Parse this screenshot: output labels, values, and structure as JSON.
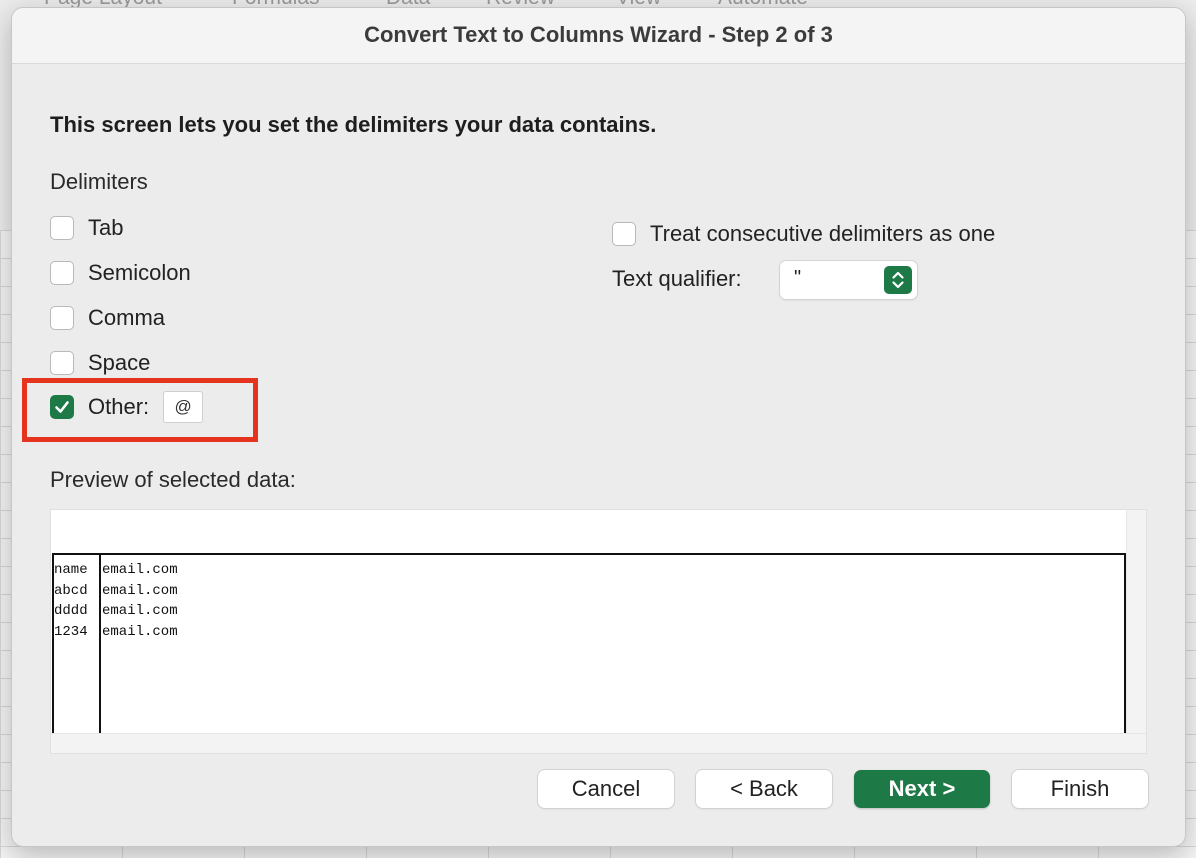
{
  "background": {
    "ribbon_tabs": [
      "Page Layout",
      "Formulas",
      "Data",
      "Review",
      "View",
      "Automate"
    ]
  },
  "dialog": {
    "title": "Convert Text to Columns Wizard - Step 2 of 3",
    "intro": "This screen lets you set the delimiters your data contains.",
    "delimiters_label": "Delimiters",
    "delimiters": [
      {
        "label": "Tab",
        "checked": false
      },
      {
        "label": "Semicolon",
        "checked": false
      },
      {
        "label": "Comma",
        "checked": false
      },
      {
        "label": "Space",
        "checked": false
      },
      {
        "label": "Other:",
        "checked": true
      }
    ],
    "other_value": "@",
    "consecutive_label": "Treat consecutive delimiters as one",
    "consecutive_checked": false,
    "qualifier_label": "Text qualifier:",
    "qualifier_value": "\"",
    "preview_label": "Preview of selected data:",
    "preview_columns": [
      [
        "name",
        "abcd",
        "dddd",
        "1234"
      ],
      [
        "email.com",
        "email.com",
        "email.com",
        "email.com"
      ]
    ],
    "buttons": {
      "cancel": "Cancel",
      "back": "< Back",
      "next": "Next >",
      "finish": "Finish"
    },
    "colors": {
      "accent": "#1d7a46",
      "highlight": "#e5341d"
    }
  }
}
